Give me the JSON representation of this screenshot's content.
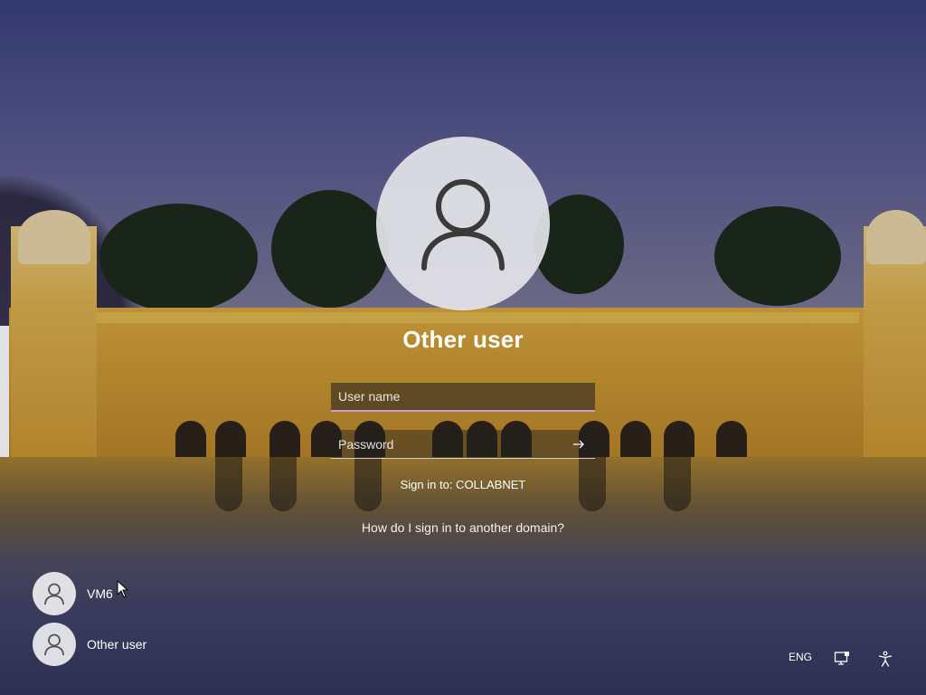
{
  "signin": {
    "account_title": "Other user",
    "username_placeholder": "User name",
    "password_placeholder": "Password",
    "sign_in_to": "Sign in to: COLLABNET",
    "other_domain_link": "How do I sign in to another domain?"
  },
  "users": [
    {
      "name": "VM6"
    },
    {
      "name": "Other user"
    }
  ],
  "tray": {
    "language": "ENG",
    "network_icon": "network-icon",
    "accessibility_icon": "accessibility-icon"
  },
  "colors": {
    "focus_accent": "#c79ad8",
    "avatar_bg": "#e4e4e8",
    "avatar_glyph": "#3a3a3a"
  }
}
